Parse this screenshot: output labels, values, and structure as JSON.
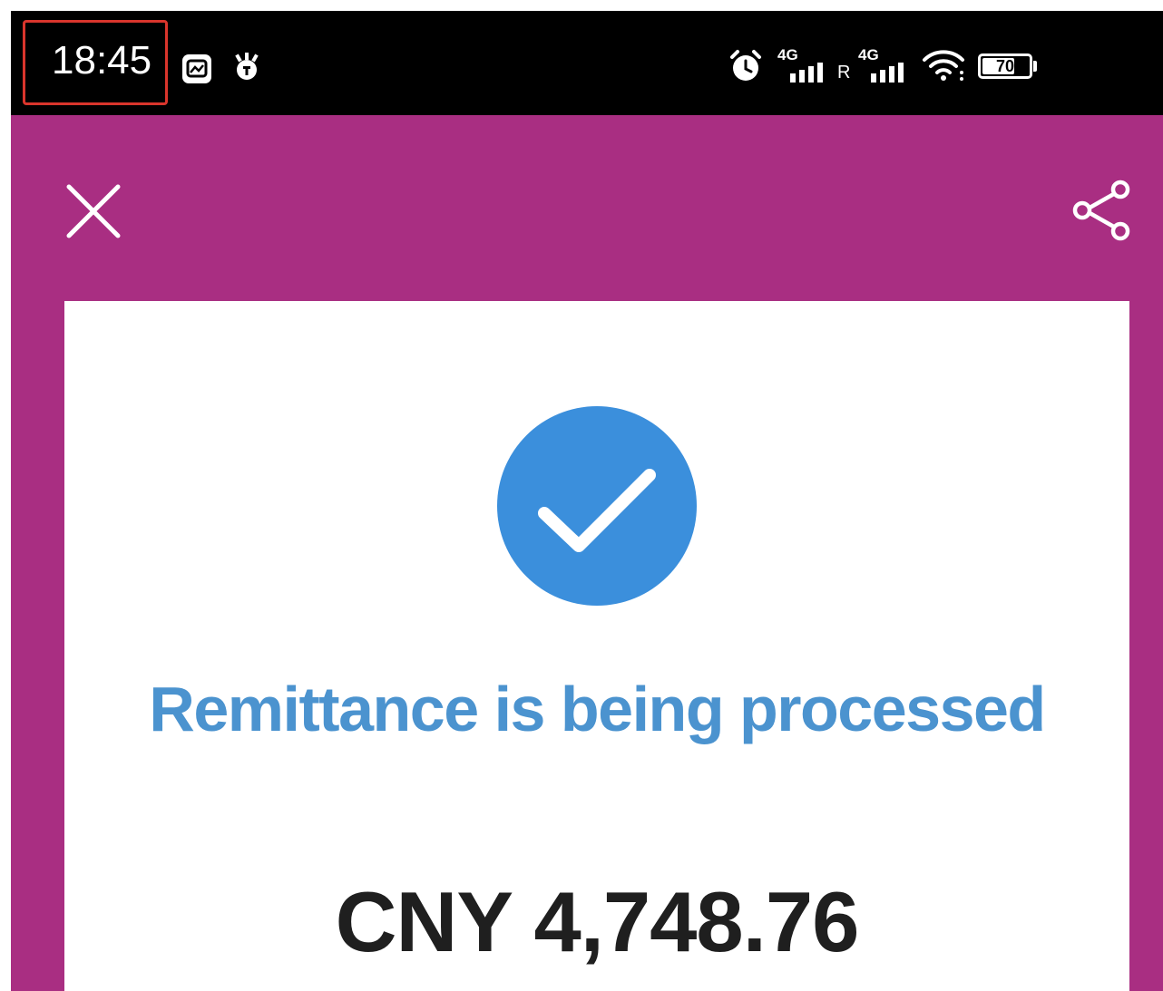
{
  "status_bar": {
    "time": "18:45",
    "network_1": "4G",
    "roaming": "R",
    "network_2": "4G",
    "battery_percent": "70",
    "battery_level": 0.7,
    "icons": [
      "gallery-icon",
      "notification-icon",
      "alarm-icon",
      "signal-icon",
      "wifi-icon",
      "battery-icon"
    ]
  },
  "toolbar": {
    "close_icon": "close-icon",
    "share_icon": "share-icon"
  },
  "result": {
    "icon": "check-circle-icon",
    "status_message": "Remittance is being processed",
    "amount": "CNY 4,748.76"
  },
  "colors": {
    "brand": "#a92e82",
    "accent": "#3b8fdc",
    "headline": "#4b93cf",
    "amount_text": "#1f1f1f",
    "highlight_box": "#d9352c"
  }
}
